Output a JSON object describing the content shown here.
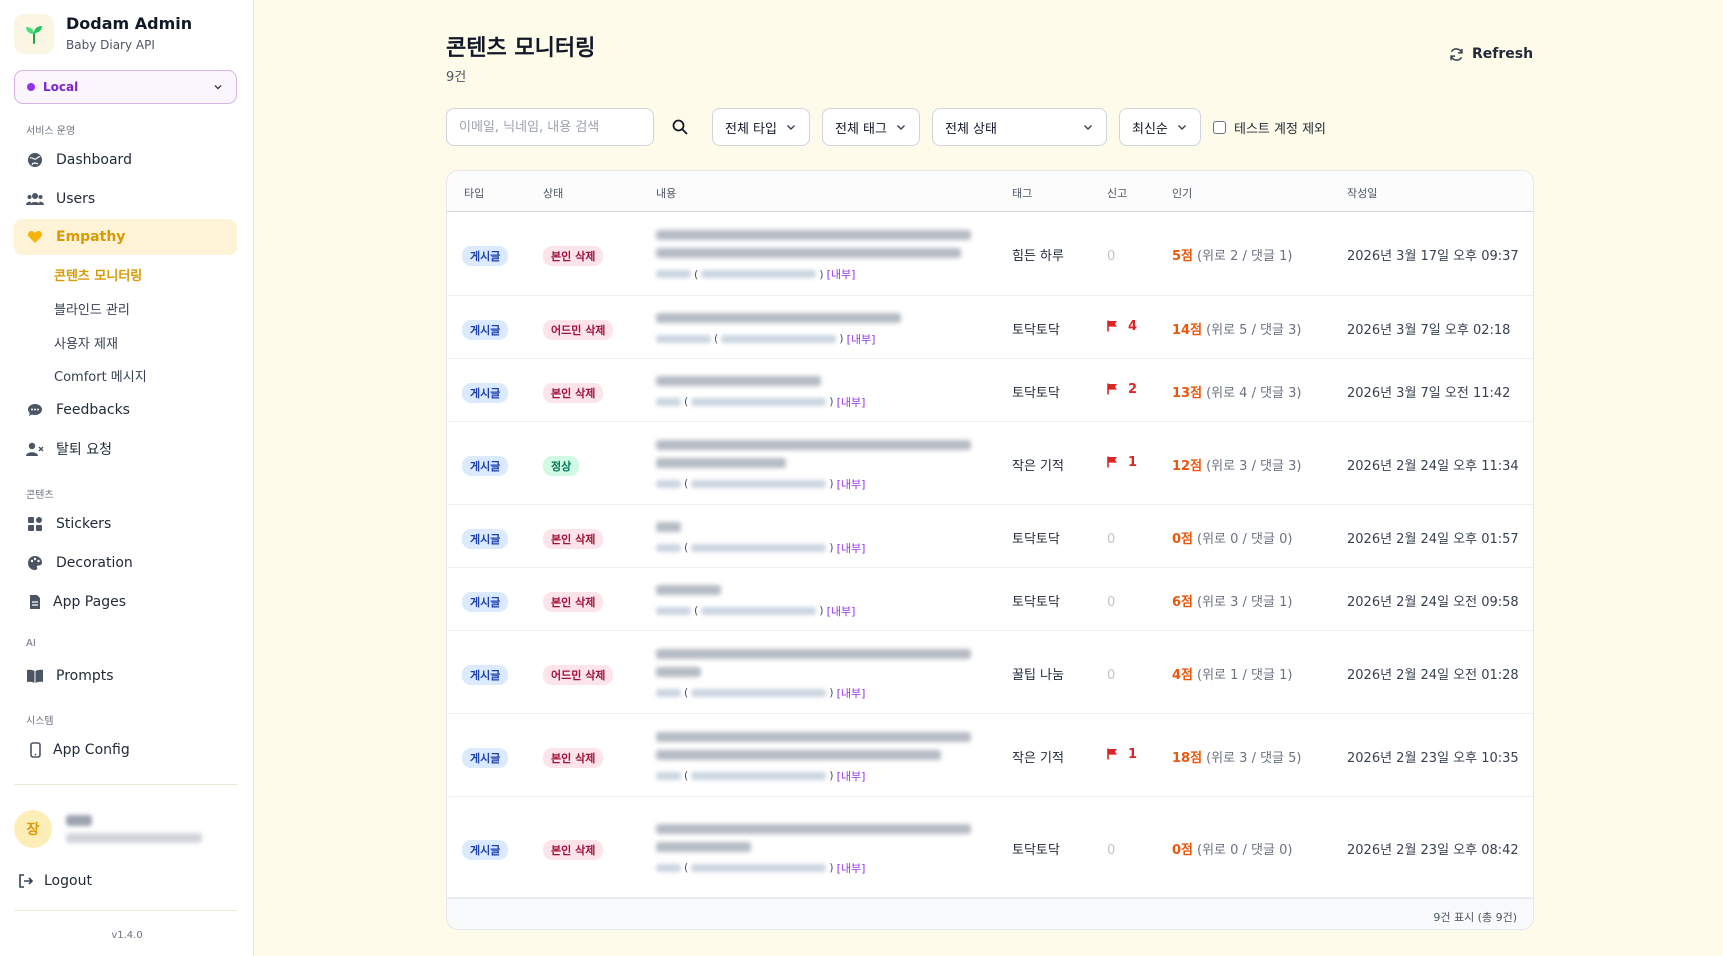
{
  "brand": {
    "title": "Dodam Admin",
    "subtitle": "Baby Diary API"
  },
  "env": {
    "label": "Local"
  },
  "sidebar": {
    "sections": [
      "서비스 운영",
      "콘텐츠",
      "AI",
      "시스템"
    ],
    "items": [
      {
        "label": "Dashboard",
        "icon": "globe-icon"
      },
      {
        "label": "Users",
        "icon": "users-icon"
      },
      {
        "label": "Empathy",
        "icon": "heart-icon"
      },
      {
        "label": "Feedbacks",
        "icon": "chat-icon"
      },
      {
        "label": "탈퇴 요청",
        "icon": "user-x-icon"
      },
      {
        "label": "Stickers",
        "icon": "grid-icon"
      },
      {
        "label": "Decoration",
        "icon": "palette-icon"
      },
      {
        "label": "App Pages",
        "icon": "file-icon"
      },
      {
        "label": "Prompts",
        "icon": "book-icon"
      },
      {
        "label": "App Config",
        "icon": "phone-icon"
      }
    ],
    "sub_items": [
      "콘텐츠 모니터링",
      "블라인드 관리",
      "사용자 제재",
      "Comfort 메시지"
    ]
  },
  "user": {
    "avatar": "장"
  },
  "logout_label": "Logout",
  "version": "v1.4.0",
  "page": {
    "title": "콘텐츠 모니터링",
    "count": "9건"
  },
  "refresh_label": "Refresh",
  "filters": {
    "search_placeholder": "이메일, 닉네임, 내용 검색",
    "type": "전체 타입",
    "tag": "전체 태그",
    "status": "전체 상태",
    "sort": "최신순",
    "exclude_test": "테스트 계정 제외"
  },
  "table": {
    "headers": [
      "타입",
      "상태",
      "내용",
      "태그",
      "신고",
      "인기",
      "작성일"
    ],
    "internal_label": "[내부]",
    "rows": [
      {
        "type": "게시글",
        "status": "본인 삭제",
        "status_kind": "deleted",
        "tag": "힘든 하루",
        "reports": "0",
        "score": "5점",
        "detail": "(위로 2 / 댓글 1)",
        "date": "2026년 3월 17일 오후 09:37"
      },
      {
        "type": "게시글",
        "status": "어드민 삭제",
        "status_kind": "deleted",
        "tag": "토닥토닥",
        "reports": "4",
        "score": "14점",
        "detail": "(위로 5 / 댓글 3)",
        "date": "2026년 3월 7일 오후 02:18"
      },
      {
        "type": "게시글",
        "status": "본인 삭제",
        "status_kind": "deleted",
        "tag": "토닥토닥",
        "reports": "2",
        "score": "13점",
        "detail": "(위로 4 / 댓글 3)",
        "date": "2026년 3월 7일 오전 11:42"
      },
      {
        "type": "게시글",
        "status": "정상",
        "status_kind": "normal",
        "tag": "작은 기적",
        "reports": "1",
        "score": "12점",
        "detail": "(위로 3 / 댓글 3)",
        "date": "2026년 2월 24일 오후 11:34"
      },
      {
        "type": "게시글",
        "status": "본인 삭제",
        "status_kind": "deleted",
        "tag": "토닥토닥",
        "reports": "0",
        "score": "0점",
        "detail": "(위로 0 / 댓글 0)",
        "date": "2026년 2월 24일 오후 01:57"
      },
      {
        "type": "게시글",
        "status": "본인 삭제",
        "status_kind": "deleted",
        "tag": "토닥토닥",
        "reports": "0",
        "score": "6점",
        "detail": "(위로 3 / 댓글 1)",
        "date": "2026년 2월 24일 오전 09:58"
      },
      {
        "type": "게시글",
        "status": "어드민 삭제",
        "status_kind": "deleted",
        "tag": "꿀팁 나눔",
        "reports": "0",
        "score": "4점",
        "detail": "(위로 1 / 댓글 1)",
        "date": "2026년 2월 24일 오전 01:28"
      },
      {
        "type": "게시글",
        "status": "본인 삭제",
        "status_kind": "deleted",
        "tag": "작은 기적",
        "reports": "1",
        "score": "18점",
        "detail": "(위로 3 / 댓글 5)",
        "date": "2026년 2월 23일 오후 10:35"
      },
      {
        "type": "게시글",
        "status": "본인 삭제",
        "status_kind": "deleted",
        "tag": "토닥토닥",
        "reports": "0",
        "score": "0점",
        "detail": "(위로 0 / 댓글 0)",
        "date": "2026년 2월 23일 오후 08:42"
      }
    ],
    "footer": "9건 표시 (총 9건)"
  },
  "colors": {
    "accent": "#d99a06",
    "background": "#fefbea",
    "report": "#dc2626",
    "score": "#ea580c",
    "internal": "#9333ea"
  }
}
